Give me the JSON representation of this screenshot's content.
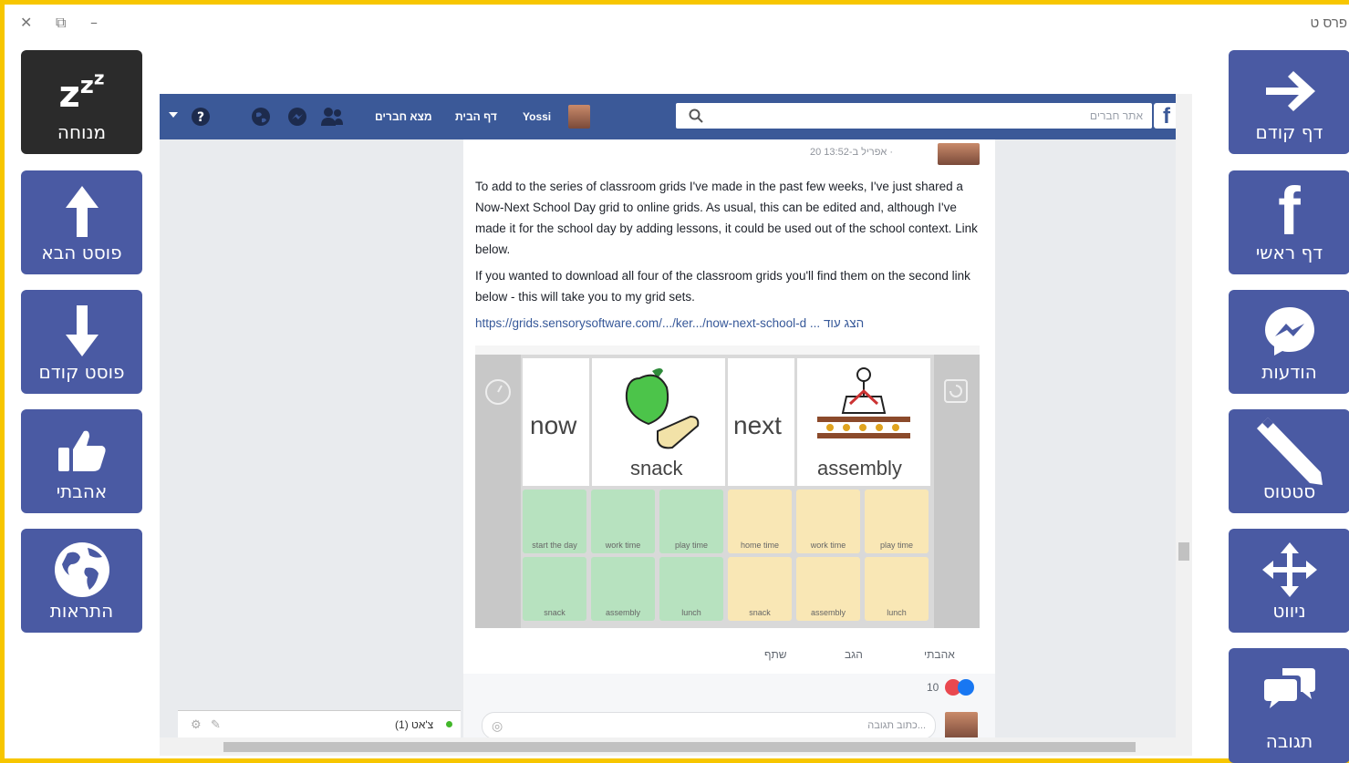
{
  "window": {
    "title": "פרס ט",
    "controls": {
      "close": "✕",
      "restore": "⧉",
      "minimize": "–"
    }
  },
  "left_panel": [
    {
      "id": "rest",
      "label": "מנוחה",
      "icon": "zzz-icon",
      "glyph": "zzz"
    },
    {
      "id": "next-post",
      "label": "פוסט הבא",
      "icon": "arrow-up-icon"
    },
    {
      "id": "prev-post",
      "label": "פוסט קודם",
      "icon": "arrow-down-icon"
    },
    {
      "id": "like",
      "label": "אהבתי",
      "icon": "thumbs-up-icon"
    },
    {
      "id": "notifications",
      "label": "התראות",
      "icon": "globe-icon"
    }
  ],
  "right_panel": [
    {
      "id": "back",
      "label": "דף קודם",
      "icon": "arrow-right-icon"
    },
    {
      "id": "home",
      "label": "דף ראשי",
      "icon": "facebook-icon"
    },
    {
      "id": "messages",
      "label": "הודעות",
      "icon": "messenger-icon"
    },
    {
      "id": "status",
      "label": "סטטוס",
      "icon": "pencil-icon"
    },
    {
      "id": "navigate",
      "label": "ניווט",
      "icon": "move-icon"
    },
    {
      "id": "reply",
      "label": "תגובה",
      "icon": "speech-bubbles-icon"
    }
  ],
  "fb": {
    "search_placeholder": "אתר חברים",
    "user_name": "Yossi",
    "nav_home": "דף הבית",
    "nav_find_friends": "מצא חברים",
    "post_time": "20 אפריל ב-13:52 · ",
    "post_p1": "To add to the series of classroom grids I've made in the past few weeks, I've just shared a Now-Next School Day grid to online grids. As usual, this can be edited and, although I've made it for the school day by adding lessons, it could be used out of the school context. Link below.",
    "post_p2": "If you wanted to download all four of the classroom grids you'll find them on the second link below - this will take you to my grid sets.",
    "post_link": "https://grids.sensorysoftware.com/.../ker.../now-next-school-d",
    "see_more": "... הצג עוד",
    "grid": {
      "now": "now",
      "next": "next",
      "snack": "snack",
      "assembly": "assembly",
      "row1": [
        "start the day",
        "work time",
        "play time",
        "home time",
        "work time",
        "play time"
      ],
      "row2": [
        "snack",
        "assembly",
        "lunch",
        "snack",
        "assembly",
        "lunch"
      ]
    },
    "action_like": "אהבתי",
    "action_comment": "הגב",
    "action_share": "שתף",
    "reactions_count": "10",
    "comment_placeholder": "כתוב תגובה...",
    "chat_label": "צ'אט (1)"
  }
}
